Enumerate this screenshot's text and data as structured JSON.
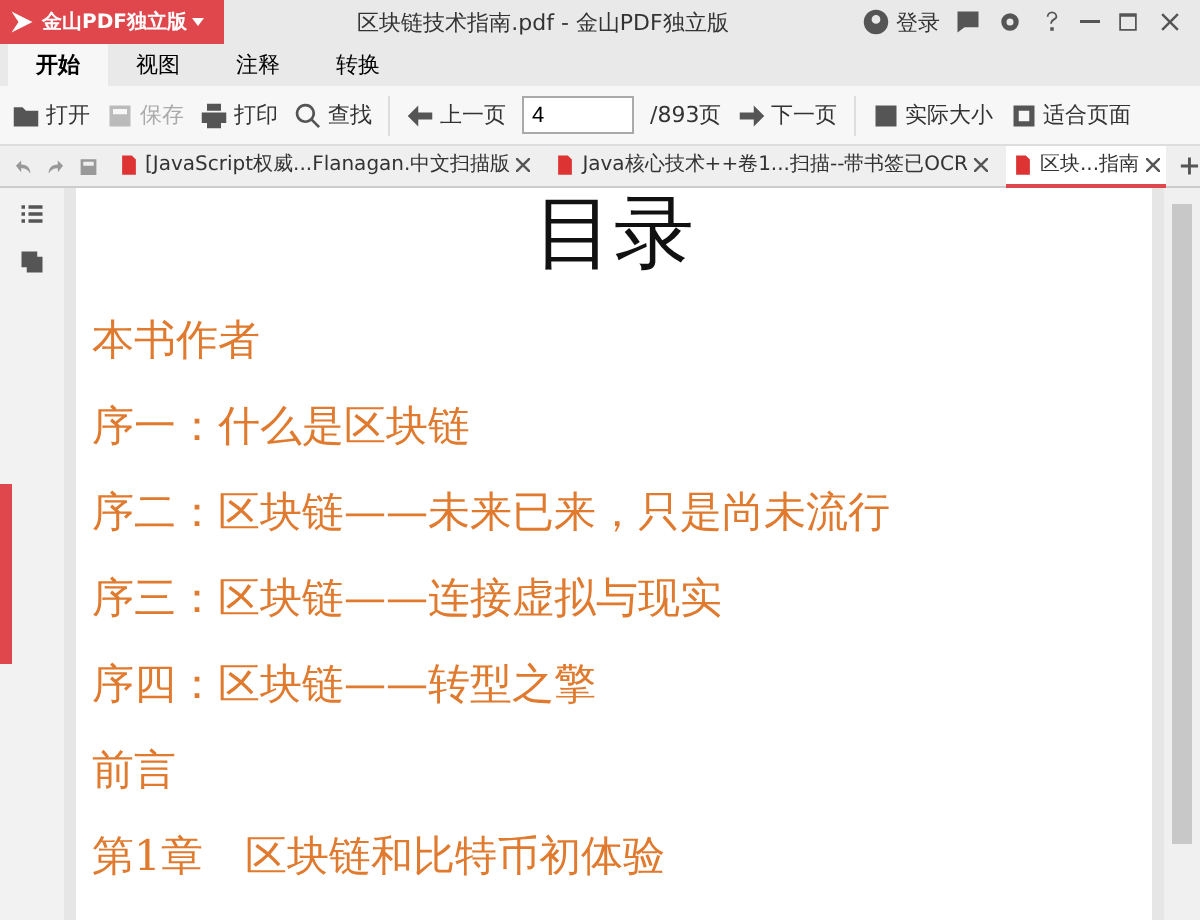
{
  "app": {
    "brand": "金山PDF独立版"
  },
  "window": {
    "title": "区块链技术指南.pdf - 金山PDF独立版",
    "login": "登录"
  },
  "ribbon_tabs": [
    {
      "label": "开始",
      "selected": true
    },
    {
      "label": "视图",
      "selected": false
    },
    {
      "label": "注释",
      "selected": false
    },
    {
      "label": "转换",
      "selected": false
    }
  ],
  "toolbar": {
    "open": "打开",
    "save": "保存",
    "print": "打印",
    "find": "查找",
    "prev": "上一页",
    "page": "4",
    "total": "/893页",
    "next": "下一页",
    "actual_size": "实际大小",
    "fit_page": "适合页面"
  },
  "doc_tabs": [
    {
      "label": "[JavaScript权威...Flanagan.中文扫描版",
      "selected": false
    },
    {
      "label": "Java核心技术++卷1...扫描--带书签已OCR",
      "selected": false
    },
    {
      "label": "区块...指南",
      "selected": true
    }
  ],
  "document": {
    "heading": "目录",
    "entries": [
      "本书作者",
      "序一：什么是区块链",
      "序二：区块链——未来已来，只是尚未流行",
      "序三：区块链——连接虚拟与现实",
      "序四：区块链——转型之擎",
      "前言",
      "第1章　区块链和比特币初体验"
    ]
  }
}
